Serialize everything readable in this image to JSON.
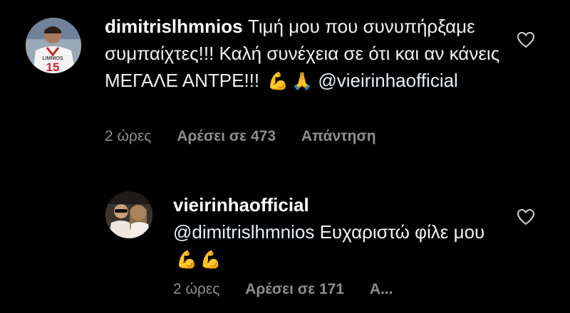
{
  "comments": [
    {
      "username": "dimitrislhmnios",
      "text": "Τιμή μου που συνυπήρξαμε συμπαίχτες!!! Καλή συνέχεια σε ότι και αν κάνεις ΜΕΓΑΛΕ ΑΝΤΡΕ!!!",
      "emojis": [
        "💪",
        "🙏"
      ],
      "mention": "@vieirinhaofficial",
      "avatar_jersey": {
        "name": "LIMNIOS",
        "number": "15"
      },
      "time": "2 ώρες",
      "likes": "Αρέσει σε 473",
      "reply": "Απάντηση",
      "like_icon": "heart-outline-icon"
    },
    {
      "username": "vieirinhaofficial",
      "mention": "@dimitrislhmnios",
      "text": "Ευχαριστώ φίλε μου",
      "emojis": [
        "💪",
        "💪"
      ],
      "time": "2 ώρες",
      "likes": "Αρέσει σε 171",
      "reply": "Α...",
      "like_icon": "heart-outline-icon"
    }
  ],
  "colors": {
    "background": "#000000",
    "text": "#f2f2f2",
    "meta": "#8e8e8e"
  }
}
